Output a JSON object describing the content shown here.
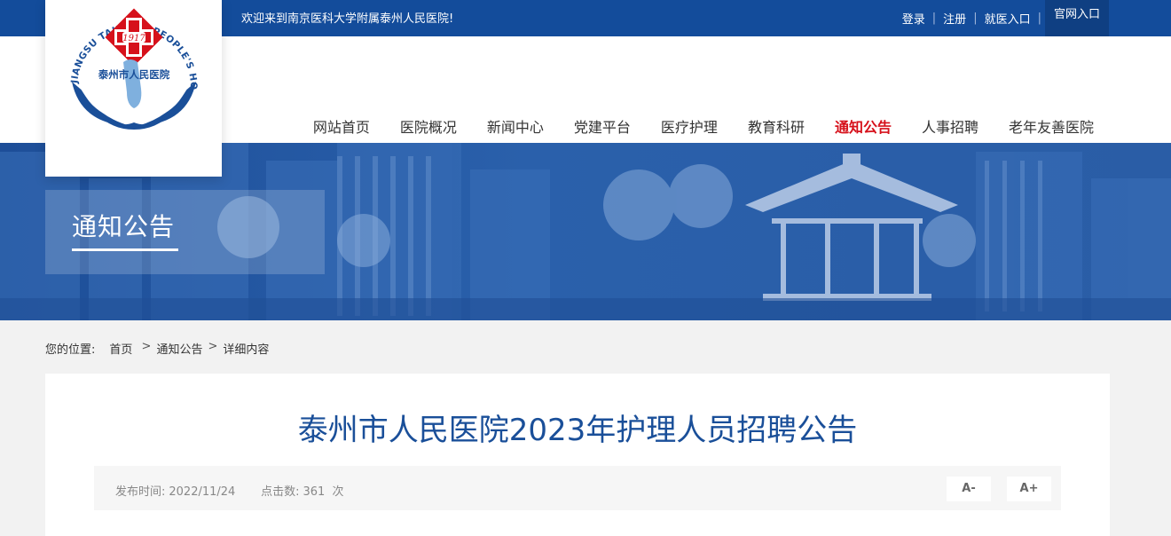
{
  "topbar": {
    "welcome": "欢迎来到南京医科大学附属泰州人民医院!",
    "links": [
      "登录",
      "注册",
      "就医入口"
    ],
    "official": "官网入口"
  },
  "logo": {
    "name_cn": "泰州市人民医院",
    "arc_text": "JIANGSU TAIZHOU PEOPLE'S HOSPITAL",
    "year": "1917"
  },
  "nav": {
    "items": [
      "网站首页",
      "医院概况",
      "新闻中心",
      "党建平台",
      "医疗护理",
      "教育科研",
      "通知公告",
      "人事招聘",
      "老年友善医院"
    ],
    "active": "通知公告"
  },
  "banner": {
    "title": "通知公告"
  },
  "breadcrumb": {
    "label": "您的位置:",
    "items": [
      "首页",
      "通知公告",
      "详细内容"
    ]
  },
  "article": {
    "title": "泰州市人民医院2023年护理人员招聘公告",
    "publish_label": "发布时间:",
    "publish_date": "2022/11/24",
    "clicks_label": "点击数:",
    "clicks": "361",
    "clicks_unit": "次",
    "font_minus": "A-",
    "font_plus": "A+"
  },
  "colors": {
    "primary": "#134c9b",
    "accent": "#d6111b",
    "title": "#1a4f99"
  }
}
